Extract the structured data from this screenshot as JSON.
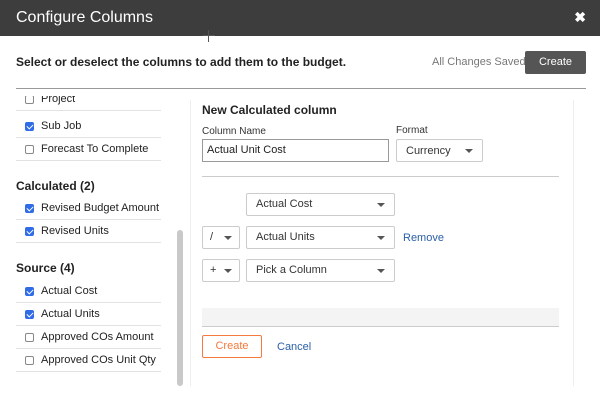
{
  "dialog": {
    "title": "Configure Columns",
    "close_glyph": "✖",
    "instructions": "Select or deselect the columns to add them to the budget.",
    "saved_status": "All Changes Saved",
    "create_label": "Create"
  },
  "sidebar": {
    "rows_top": [
      {
        "label": "Project",
        "checked": false
      },
      {
        "label": "Sub Job",
        "checked": true
      },
      {
        "label": "Forecast To Complete",
        "checked": false
      }
    ],
    "calculated_header": "Calculated (2)",
    "calculated": [
      {
        "label": "Revised Budget Amount",
        "checked": true
      },
      {
        "label": "Revised Units",
        "checked": true
      }
    ],
    "source_header": "Source (4)",
    "source": [
      {
        "label": "Actual Cost",
        "checked": true
      },
      {
        "label": "Actual Units",
        "checked": true
      },
      {
        "label": "Approved COs Amount",
        "checked": false
      },
      {
        "label": "Approved COs Unit Qty",
        "checked": false
      }
    ]
  },
  "panel": {
    "title": "New Calculated column",
    "column_name_label": "Column Name",
    "column_name_value": "Actual Unit Cost",
    "format_label": "Format",
    "format_value": "Currency",
    "formula": [
      {
        "operator": "",
        "column": "Actual Cost"
      },
      {
        "operator": "/",
        "column": "Actual Units",
        "remove_label": "Remove"
      },
      {
        "operator": "+",
        "column": "Pick a Column"
      }
    ],
    "create_label": "Create",
    "cancel_label": "Cancel"
  },
  "colors": {
    "titlebar": "#3d3d3d",
    "checkbox_checked": "#2f6ce5",
    "create_outline": "#f47a3d",
    "link": "#2a5fa8"
  }
}
